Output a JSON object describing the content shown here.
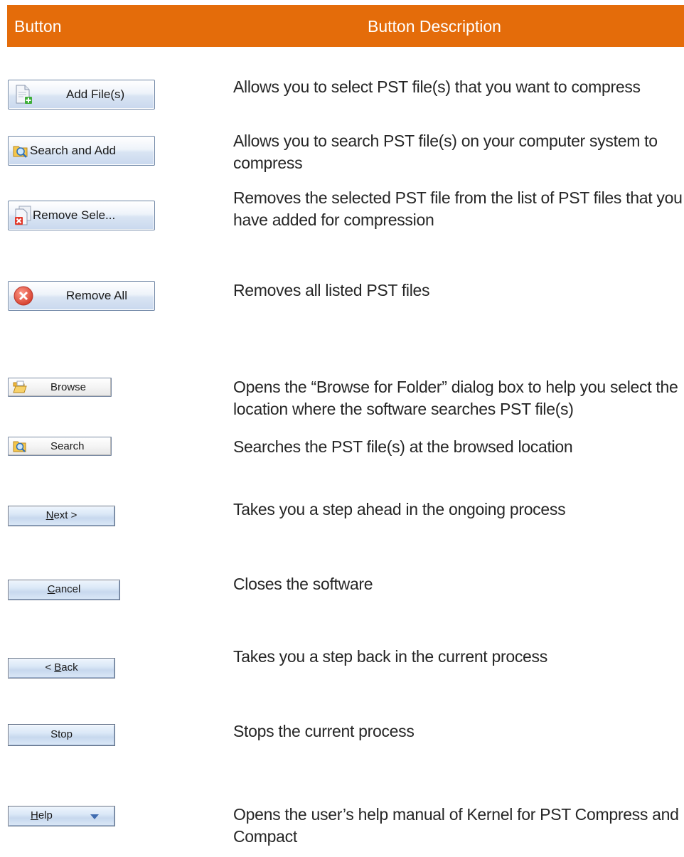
{
  "header": {
    "col_button": "Button",
    "col_description": "Button Description"
  },
  "rows": [
    {
      "button_label": "Add File(s)",
      "icon": "document-add-icon",
      "description": "Allows you to select PST file(s)  that you want to compress"
    },
    {
      "button_label": "Search and Add",
      "icon": "search-folder-icon",
      "description": "Allows you to search PST file(s)  on your computer system to compress"
    },
    {
      "button_label": "Remove Sele...",
      "icon": "document-remove-icon",
      "description": "Removes the selected PST file from the list   of PST files that you have added for compression"
    },
    {
      "button_label": "Remove All",
      "icon": "remove-circle-icon",
      "description": "Removes all  listed PST files"
    },
    {
      "button_label": "Browse",
      "icon": "folder-open-icon",
      "description": "Opens the “Browse for Folder” dialog box to help you select  the location where the software searches PST file(s)"
    },
    {
      "button_label": "Search",
      "icon": "search-folder-icon",
      "description": "Searches the PST file(s)  at the browsed location"
    },
    {
      "button_label": "Next >",
      "mnemonic": "N",
      "description": "Takes you a step ahead in the ongoing process"
    },
    {
      "button_label": "Cancel",
      "mnemonic": "C",
      "description": "Closes the software"
    },
    {
      "button_label": "< Back",
      "mnemonic": "B",
      "description": "Takes you a step back in the current process"
    },
    {
      "button_label": "Stop",
      "description": "Stops the current process"
    },
    {
      "button_label": "Help",
      "mnemonic": "H",
      "icon": "chevron-down-icon",
      "description": "Opens the user’s help manual of Kernel for PST Compress and Compact"
    }
  ],
  "colors": {
    "header_bg": "#E46C0A",
    "header_text": "#FFFFFF",
    "body_text": "#262626"
  }
}
